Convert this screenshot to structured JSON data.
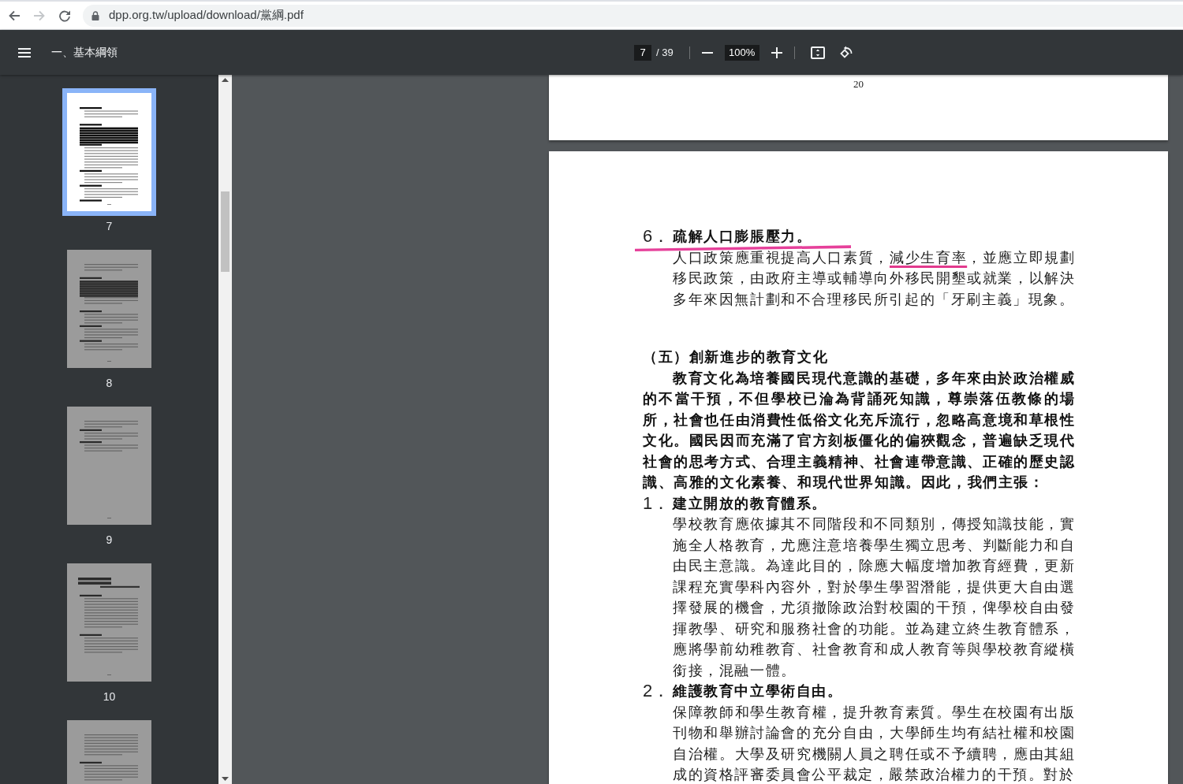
{
  "browser": {
    "nav_buttons": [
      {
        "kind": "back",
        "disabled": false
      },
      {
        "kind": "forward",
        "disabled": true
      },
      {
        "kind": "reload",
        "disabled": false
      }
    ],
    "url": "dpp.org.tw/upload/download/黨綱.pdf"
  },
  "toolbar": {
    "title": "一、基本綱領",
    "page_field": {
      "value": "7"
    },
    "page_total": "/ 39",
    "zoom_field": {
      "value": "100%"
    }
  },
  "thumbnails": [
    {
      "label": "7",
      "selected": true
    },
    {
      "label": "8",
      "selected": false
    },
    {
      "label": "9",
      "selected": false
    },
    {
      "label": "10",
      "selected": false
    },
    {
      "selected": false
    }
  ],
  "pages": [
    {
      "kind": "page_end",
      "page_number": "20"
    },
    {
      "kind": "page",
      "blocks": [
        {
          "kind": "item_heading",
          "number": "6．",
          "title": "疏解人口膨脹壓力。",
          "underlined": true
        },
        {
          "kind": "item_text",
          "lines": [
            [
              {
                "text": "人口政策應重視提高人口素質，",
                "underlined": false
              },
              {
                "text": "減少生育率",
                "underlined": true
              },
              {
                "text": "，並應立即規劃",
                "underlined": false
              }
            ],
            "移民政策，由政府主導或輔導向外移民開墾或就業，以解決",
            "多年來因無計劃和不合理移民所引起的「牙刷主義」現象。"
          ]
        },
        {
          "kind": "section_heading",
          "text": "（五）創新進步的教育文化"
        },
        {
          "kind": "section_text",
          "lines": [
            "教育文化為培養國民現代意識的基礎，多年來由於政治權威",
            "的不當干預，不但學校已淪為背誦死知識，尊崇落伍教條的場",
            "所，社會也任由消費性低俗文化充斥流行，忽略高意境和草根性",
            "文化。國民因而充滿了官方刻板僵化的偏狹觀念，普遍缺乏現代",
            "社會的思考方式、合理主義精神、社會連帶意識、正確的歷史認",
            "識、高雅的文化素養、和現代世界知識。因此，我們主張："
          ]
        },
        {
          "kind": "item_heading",
          "number": "1．",
          "title": "建立開放的教育體系。",
          "underlined": false
        },
        {
          "kind": "item_text",
          "lines": [
            "學校教育應依據其不同階段和不同類別，傳授知識技能，實",
            "施全人格教育，尤應注意培養學生獨立思考、判斷能力和自",
            "由民主意識。為達此目的，除應大幅度增加教育經費，更新",
            "課程充實學科內容外，對於學生學習潛能，提供更大自由選",
            "擇發展的機會，尤須撤除政治對校園的干預，俾學校自由發",
            "揮教學、研究和服務社會的功能。並為建立終生教育體系，",
            "應將學前幼稚教育、社會教育和成人教育等與學校教育縱橫",
            "銜接，混融一體。"
          ]
        },
        {
          "kind": "item_heading",
          "number": "2．",
          "title": "維護教育中立學術自由。",
          "underlined": false
        },
        {
          "kind": "item_text",
          "lines": [
            "保障教師和學生教育權，提升教育素質。學生在校園有出版",
            "刊物和舉辦討論會的充分自由，大學師生均有結社權和校園",
            "自治權。大學及研究機關人員之聘任或不予續聘，應由其組",
            "成的資格評審委員會公平裁定，嚴禁政治權力的干預。對於"
          ]
        }
      ]
    }
  ]
}
